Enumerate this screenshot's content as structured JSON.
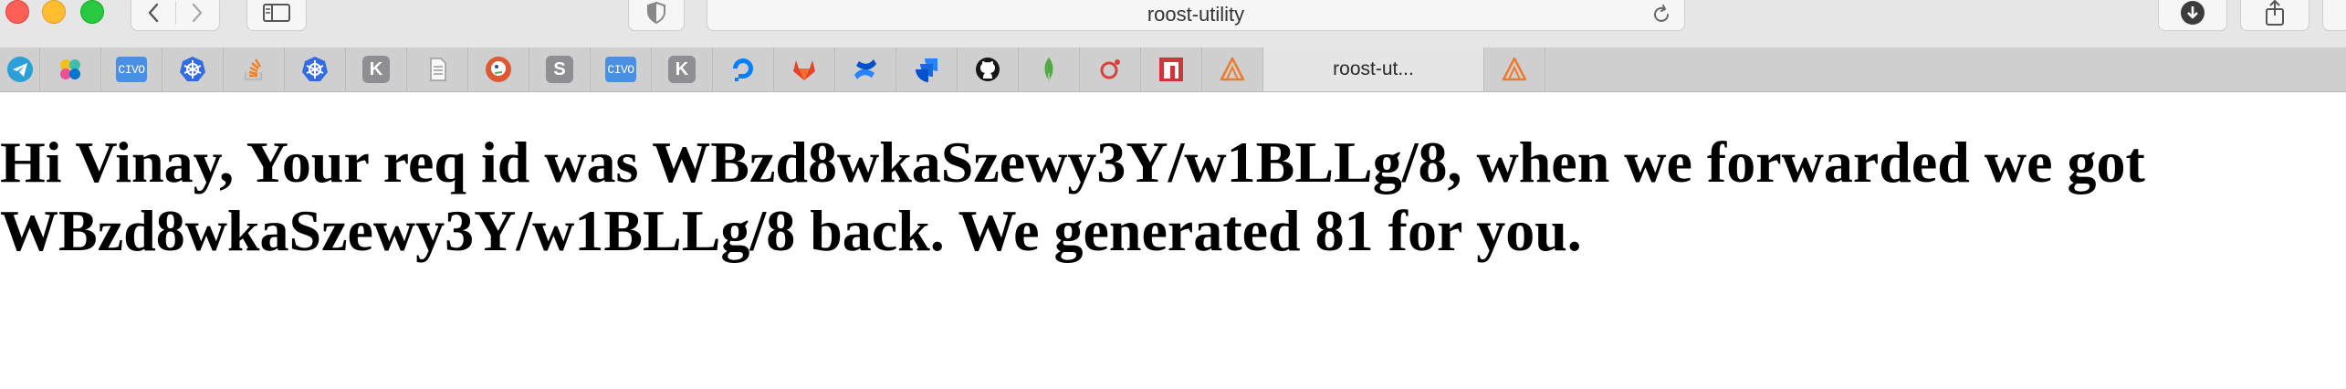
{
  "window": {
    "address_text": "roost-utility"
  },
  "favorites": [
    {
      "kind": "icon",
      "icon": "telegram-icon",
      "color": "#2a9fd8"
    },
    {
      "kind": "icon",
      "icon": "elastic-icon"
    },
    {
      "kind": "badge",
      "text": "CIVO",
      "icon": "civo-icon"
    },
    {
      "kind": "icon",
      "icon": "kubernetes-icon",
      "color": "#326ce5"
    },
    {
      "kind": "icon",
      "icon": "stackoverflow-icon",
      "color": "#f48024"
    },
    {
      "kind": "icon",
      "icon": "kubernetes-icon",
      "color": "#326ce5"
    },
    {
      "kind": "letter",
      "text": "K",
      "icon": "k-letter-icon"
    },
    {
      "kind": "icon",
      "icon": "document-icon"
    },
    {
      "kind": "icon",
      "icon": "duckduckgo-icon",
      "color": "#de5833"
    },
    {
      "kind": "letter",
      "text": "S",
      "icon": "s-letter-icon"
    },
    {
      "kind": "badge",
      "text": "CIVO",
      "icon": "civo-icon"
    },
    {
      "kind": "letter",
      "text": "K",
      "icon": "k-letter-icon"
    },
    {
      "kind": "icon",
      "icon": "digitalocean-icon",
      "color": "#0080ff"
    },
    {
      "kind": "icon",
      "icon": "gitlab-icon",
      "color": "#e24329"
    },
    {
      "kind": "icon",
      "icon": "confluence-icon",
      "color": "#2684ff"
    },
    {
      "kind": "icon",
      "icon": "jira-icon",
      "color": "#2684ff"
    },
    {
      "kind": "icon",
      "icon": "github-icon",
      "color": "#181717"
    },
    {
      "kind": "icon",
      "icon": "mongodb-icon",
      "color": "#4faa41"
    },
    {
      "kind": "icon",
      "icon": "record-icon",
      "color": "#d9423a"
    },
    {
      "kind": "icon",
      "icon": "npm-icon",
      "color": "#cb3837"
    },
    {
      "kind": "icon",
      "icon": "roost-icon",
      "color": "#f07a2b"
    },
    {
      "kind": "tab",
      "text": "roost-ut...",
      "active": true
    },
    {
      "kind": "icon",
      "icon": "roost-icon",
      "color": "#f07a2b"
    }
  ],
  "content": {
    "message": "Hi Vinay, Your req id was WBzd8wkaSzewy3Y/w1BLLg/8, when we forwarded we got WBzd8wkaSzewy3Y/w1BLLg/8 back. We generated 81 for you."
  }
}
